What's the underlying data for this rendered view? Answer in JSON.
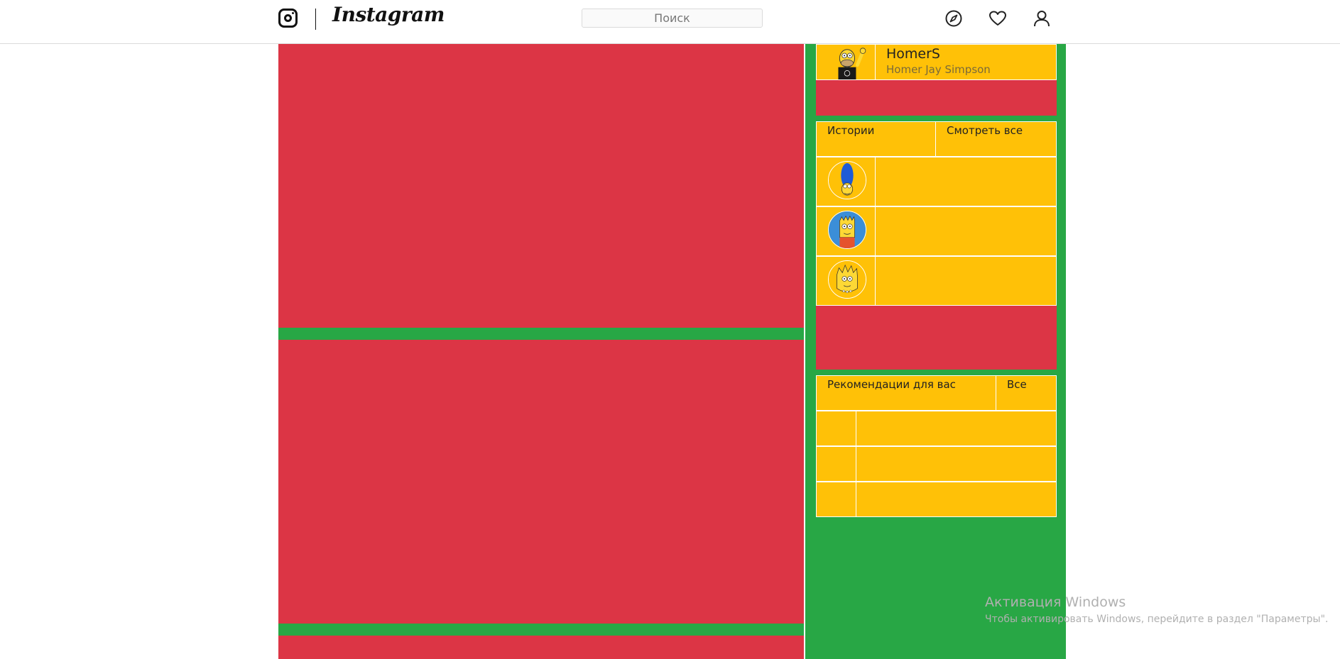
{
  "header": {
    "brand": "Instagram",
    "search_placeholder": "Поиск",
    "icons": [
      "instagram-icon",
      "compass-icon",
      "heart-icon",
      "profile-icon"
    ]
  },
  "profile": {
    "username": "HomerS",
    "full_name": "Homer Jay Simpson",
    "avatar_icon": "homer-avatar-icon"
  },
  "stories": {
    "title": "Истории",
    "view_all": "Смотреть все",
    "avatars": [
      "marge-avatar-icon",
      "bart-avatar-icon",
      "lisa-avatar-icon"
    ]
  },
  "recommendations": {
    "title": "Рекомендации для вас",
    "all": "Все"
  },
  "watermark": {
    "title": "Активация Windows",
    "subtitle": "Чтобы активировать Windows, перейдите в раздел \"Параметры\"."
  },
  "colors": {
    "red": "#dc3545",
    "green": "#28a745",
    "yellow": "#ffc107"
  }
}
